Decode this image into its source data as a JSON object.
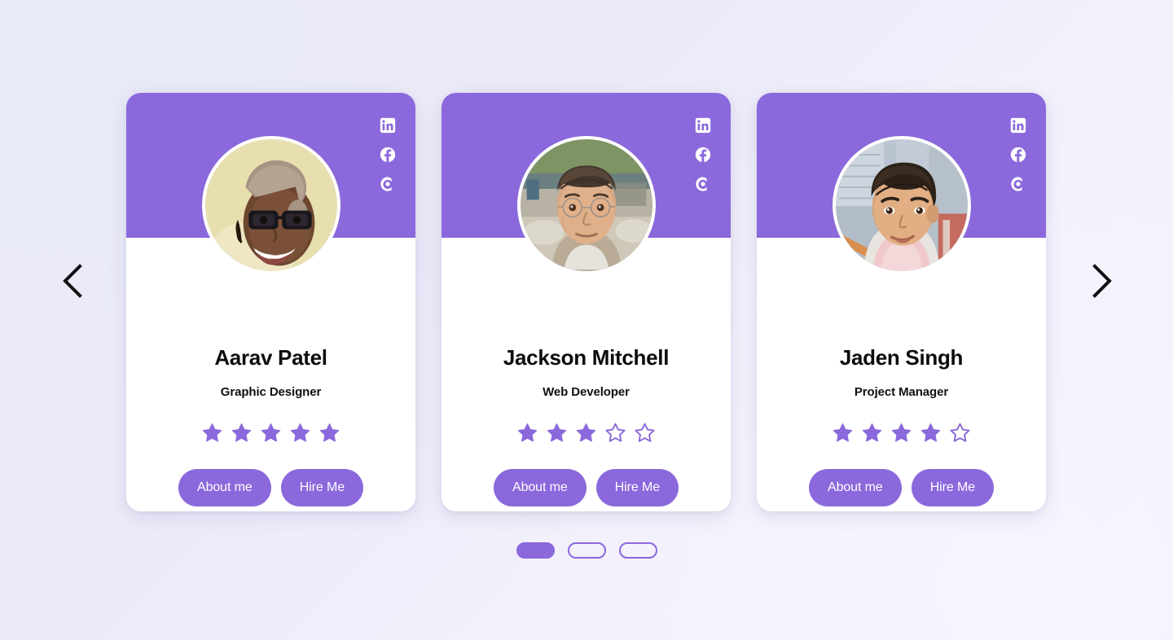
{
  "theme": {
    "accent": "#8b68dc",
    "card_bg": "#ffffff",
    "page_bg": "#ecebf9",
    "text": "#0c0c0c",
    "arrow": "#111111"
  },
  "nav": {
    "prev_label": "Previous",
    "prev_icon": "chevron-left-icon",
    "next_label": "Next",
    "next_icon": "chevron-right-icon"
  },
  "social": [
    {
      "name": "linkedin-icon",
      "label": "LinkedIn"
    },
    {
      "name": "facebook-icon",
      "label": "Facebook"
    },
    {
      "name": "coursera-icon",
      "label": "Coursera"
    }
  ],
  "cards": [
    {
      "name": "Aarav Patel",
      "role": "Graphic Designer",
      "rating": 5,
      "max_rating": 5,
      "avatar_alt": "Smiling man with glasses and knit cap",
      "about_label": "About me",
      "hire_label": "Hire Me"
    },
    {
      "name": "Jackson Mitchell",
      "role": "Web Developer",
      "rating": 3,
      "max_rating": 5,
      "avatar_alt": "Man with thin-rimmed glasses outdoors",
      "about_label": "About me",
      "hire_label": "Hire Me"
    },
    {
      "name": "Jaden Singh",
      "role": "Project Manager",
      "rating": 4,
      "max_rating": 5,
      "avatar_alt": "Young man with short dark hair in a city",
      "about_label": "About me",
      "hire_label": "Hire Me"
    }
  ],
  "pagination": {
    "count": 3,
    "active_index": 0,
    "labels": [
      "1",
      "2",
      "3"
    ]
  }
}
